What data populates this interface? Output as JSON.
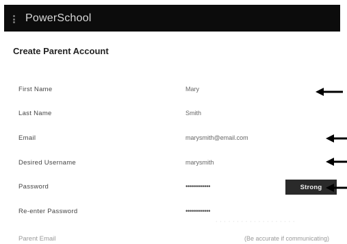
{
  "app": {
    "brand": "PowerSchool"
  },
  "page": {
    "title": "Create Parent Account"
  },
  "form": {
    "fields": [
      {
        "label": "First Name",
        "value": "Mary"
      },
      {
        "label": "Last Name",
        "value": "Smith"
      },
      {
        "label": "Email",
        "value": "marysmith@email.com"
      },
      {
        "label": "Desired Username",
        "value": "marysmith"
      },
      {
        "label": "Password",
        "value": "••••••••••••"
      },
      {
        "label": "Re-enter Password",
        "value": "••••••••••••"
      }
    ],
    "strength_label": "Strong",
    "hint": "· · · · · · · · · · · · · · · · · · ·",
    "parent_email_label": "Parent Email",
    "parent_email_value": "(Be accurate if communicating)"
  },
  "arrows": [
    {
      "target": "First Name"
    },
    {
      "target": "Email"
    },
    {
      "target": "Desired Username"
    },
    {
      "target": "Password"
    }
  ],
  "colors": {
    "topbar": "#0c0c0c",
    "strength_button": "#2a2a2a"
  }
}
